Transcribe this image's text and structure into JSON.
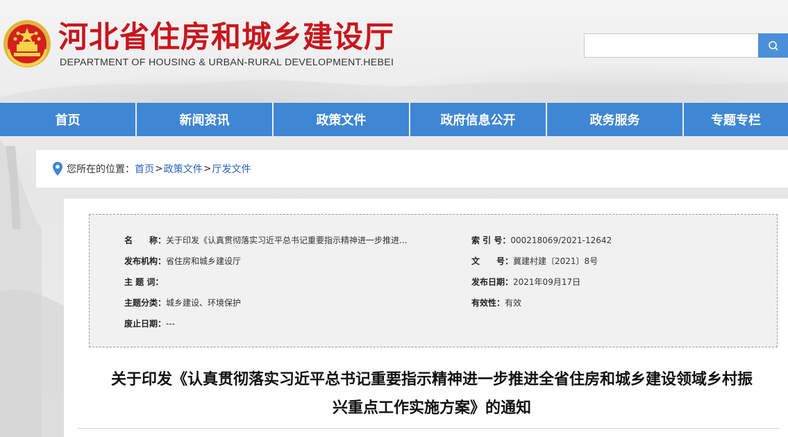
{
  "header": {
    "site_title": "河北省住房和城乡建设厅",
    "site_subtitle": "DEPARTMENT OF HOUSING & URBAN-RURAL DEVELOPMENT.HEBEI",
    "search": {
      "placeholder": "",
      "value": "",
      "icon": "search-icon"
    }
  },
  "colors": {
    "brand_red": "#c8161d",
    "nav_blue": "#3f86d4",
    "link_blue": "#2b63b8"
  },
  "nav": {
    "items": [
      {
        "label": "首页"
      },
      {
        "label": "新闻资讯"
      },
      {
        "label": "政策文件"
      },
      {
        "label": "政府信息公开"
      },
      {
        "label": "政务服务"
      },
      {
        "label": "专题专栏"
      }
    ]
  },
  "breadcrumb": {
    "prefix": "您所在的位置：",
    "items": [
      "首页",
      "政策文件",
      "厅发文件"
    ],
    "separator": ">"
  },
  "meta": {
    "name_label": "名　　称：",
    "name_value": "关于印发《认真贯彻落实习近平总书记重要指示精神进一步推进...",
    "index_label": "索 引 号：",
    "index_value": "000218069/2021-12642",
    "org_label": "发布机构：",
    "org_value": "省住房和城乡建设厅",
    "doc_no_label": "文　　号：",
    "doc_no_value": "冀建村建〔2021〕8号",
    "subject_label": "主 题 词：",
    "subject_value": "",
    "date_label": "发布日期：",
    "date_value": "2021年09月17日",
    "category_label": "主题分类：",
    "category_value": "城乡建设、环境保护",
    "validity_label": "有效性：",
    "validity_value": "有效",
    "expiry_label": "废止日期：",
    "expiry_value": "---"
  },
  "document": {
    "title_line1": "关于印发《认真贯彻落实习近平总书记重要指示精神进一步推进全省住房和城乡建设领域乡村振",
    "title_line2": "兴重点工作实施方案》的通知"
  }
}
